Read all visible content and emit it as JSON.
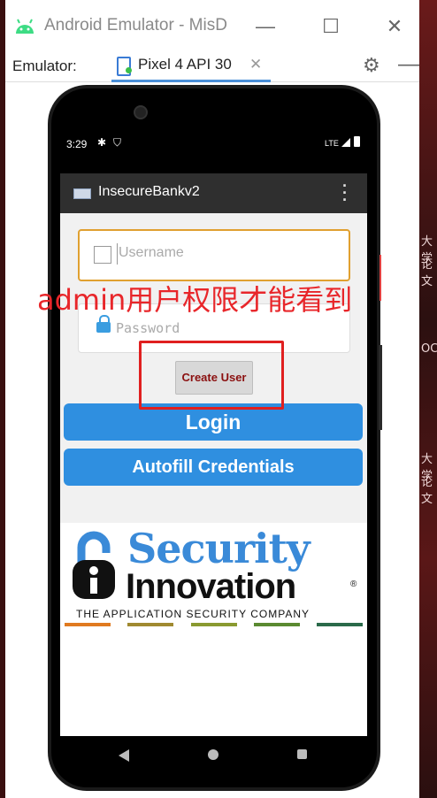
{
  "window": {
    "title": "Android Emulator - MisD"
  },
  "toolbar": {
    "label": "Emulator:",
    "device_tab": "Pixel 4 API 30"
  },
  "status": {
    "time": "3:29",
    "network": "LTE"
  },
  "app": {
    "title": "InsecureBankv2",
    "username_placeholder": "Username",
    "password_placeholder": "Password",
    "create_user": "Create User",
    "login": "Login",
    "autofill": "Autofill Credentials"
  },
  "logo": {
    "line1": "Security",
    "line2": "Innovation",
    "reg": "®",
    "tagline": "THE APPLICATION SECURITY COMPANY"
  },
  "annotation": {
    "text": "admin用户权限才能看到"
  },
  "background": {
    "right_chars": [
      "大学",
      "论文",
      "OC",
      "大学",
      "论文"
    ]
  },
  "colors": {
    "accent_blue": "#2f8fe0",
    "annotation_red": "#e8262a",
    "create_user_text": "#8b1010"
  }
}
